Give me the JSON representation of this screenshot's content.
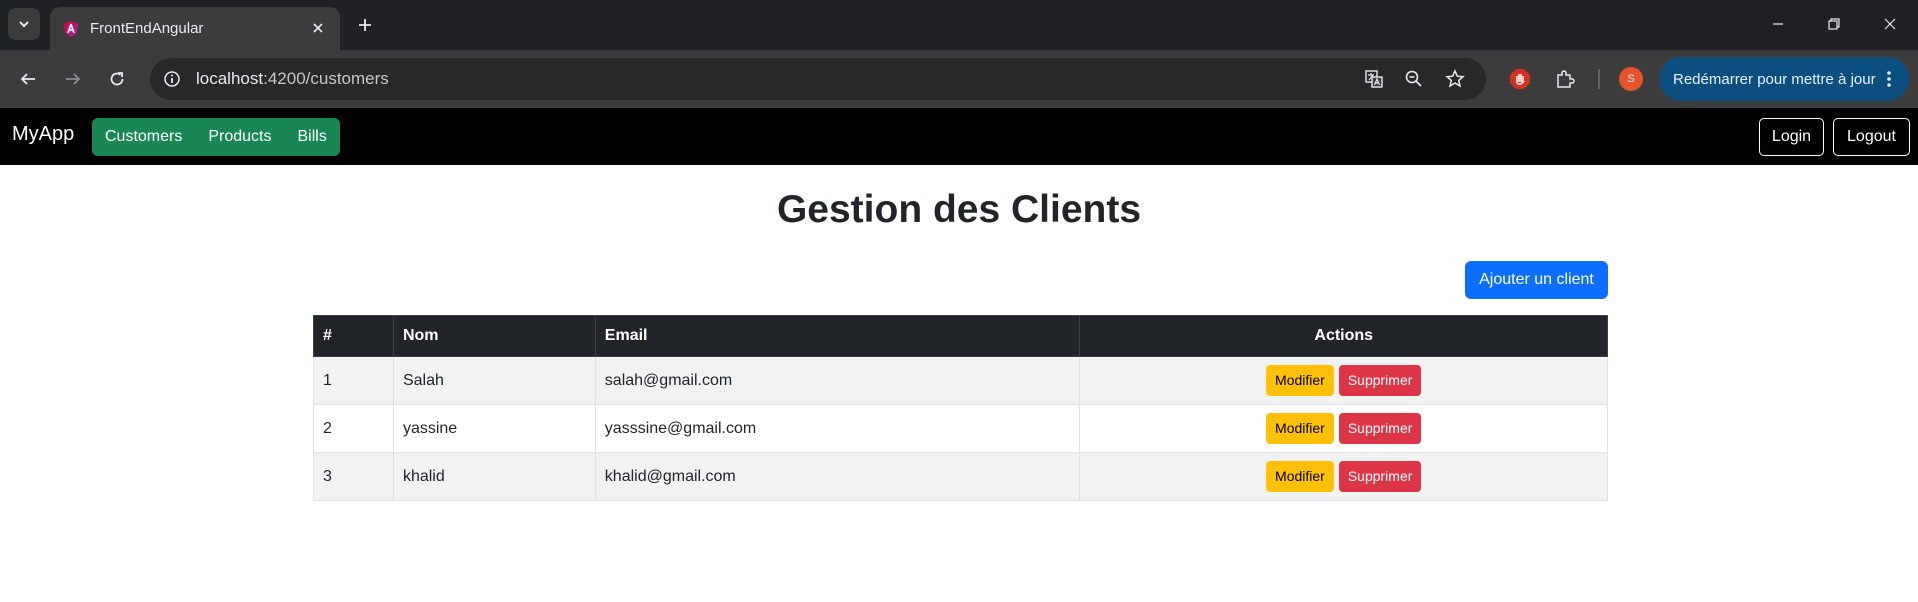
{
  "browser": {
    "tab_title": "FrontEndAngular",
    "url_host": "localhost",
    "url_path": ":4200/customers",
    "avatar_letter": "S",
    "update_label": "Redémarrer pour mettre à jour"
  },
  "navbar": {
    "brand": "MyApp",
    "links": [
      {
        "label": "Customers"
      },
      {
        "label": "Products"
      },
      {
        "label": "Bills"
      }
    ],
    "login_label": "Login",
    "logout_label": "Logout"
  },
  "page": {
    "title": "Gestion des Clients",
    "add_button": "Ajouter un client"
  },
  "table": {
    "headers": [
      "#",
      "Nom",
      "Email",
      "Actions"
    ],
    "rows": [
      {
        "id": "1",
        "nom": "Salah",
        "email": "salah@gmail.com"
      },
      {
        "id": "2",
        "nom": "yassine",
        "email": "yasssine@gmail.com"
      },
      {
        "id": "3",
        "nom": "khalid",
        "email": "khalid@gmail.com"
      }
    ],
    "edit_label": "Modifier",
    "delete_label": "Supprimer"
  },
  "colors": {
    "nav_green": "#198754",
    "primary": "#0d6efd",
    "warning": "#ffc107",
    "danger": "#dc3545"
  }
}
